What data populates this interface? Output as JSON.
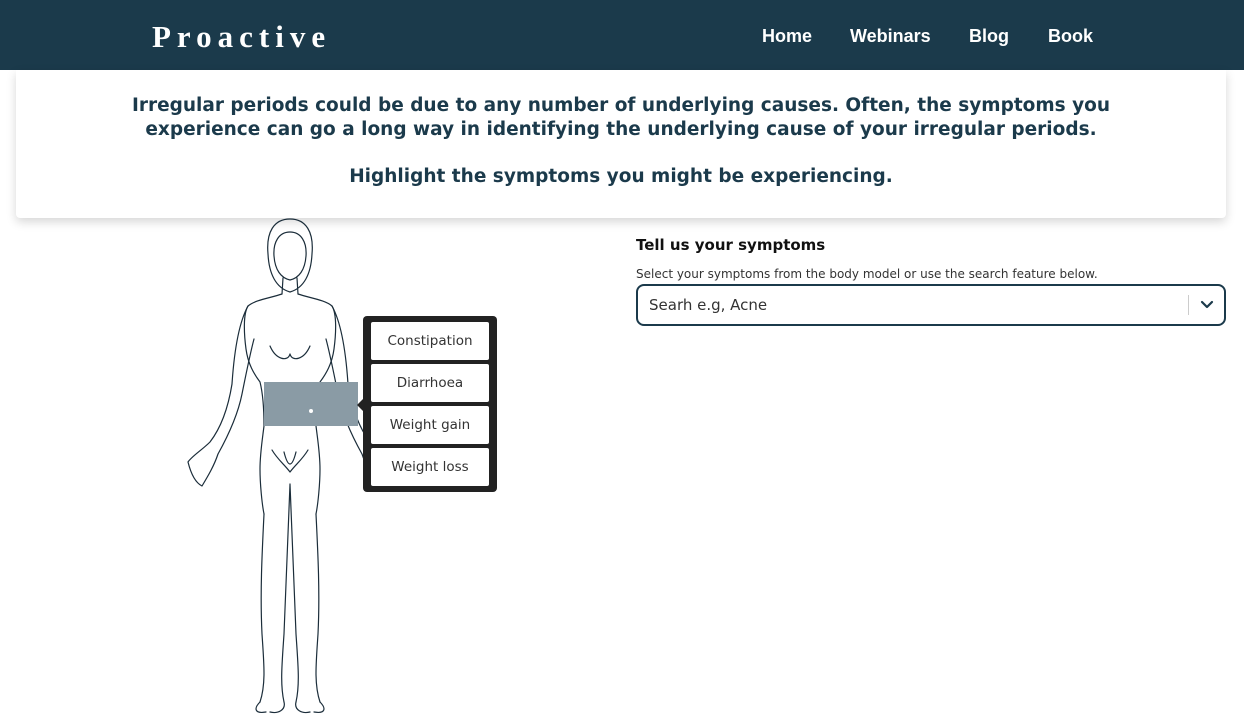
{
  "nav": {
    "brand": "Proactive",
    "links": [
      {
        "label": "Home"
      },
      {
        "label": "Webinars"
      },
      {
        "label": "Blog"
      },
      {
        "label": "Book"
      }
    ]
  },
  "intro": {
    "text": "Irregular periods could be due to any number of underlying causes. Often, the symptoms you experience can go a long way in identifying the underlying cause of your irregular periods.",
    "prompt": "Highlight the symptoms you might be experiencing."
  },
  "body_model": {
    "selected_region": "abdomen",
    "highlight_color": "#8a9ba5",
    "symptoms": [
      "Constipation",
      "Diarrhoea",
      "Weight gain",
      "Weight loss"
    ]
  },
  "symptoms_panel": {
    "title": "Tell us your symptoms",
    "help": "Select your symptoms from the body model or use the search feature below.",
    "search_placeholder": "Searh e.g, Acne"
  },
  "colors": {
    "nav_bg": "#1b3a4b",
    "popup_bg": "#222222"
  }
}
